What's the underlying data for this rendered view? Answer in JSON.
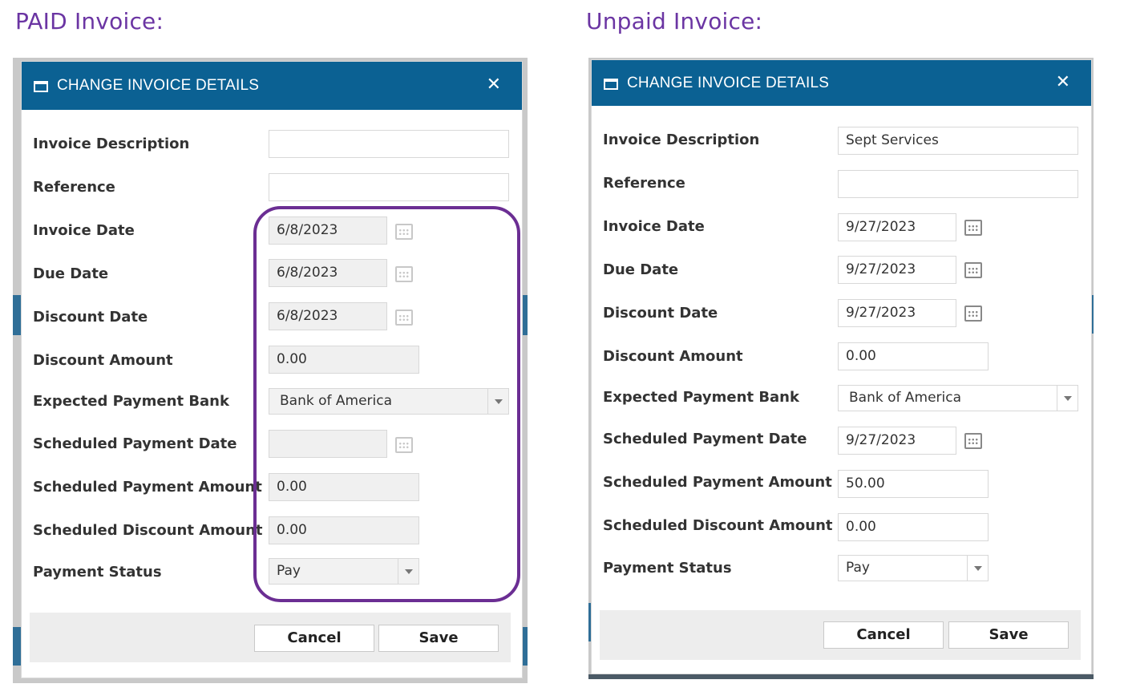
{
  "captions": {
    "paid": "PAID Invoice:",
    "unpaid": "Unpaid Invoice:"
  },
  "colors": {
    "caption": "#6b35a3",
    "titlebar": "#0b6193",
    "highlight": "#6b2e93"
  },
  "paid": {
    "title": "CHANGE INVOICE DETAILS",
    "labels": [
      "Invoice Description",
      "Reference",
      "Invoice Date",
      "Due Date",
      "Discount Date",
      "Discount Amount",
      "Expected Payment Bank",
      "Scheduled Payment Date",
      "Scheduled Payment Amount",
      "Scheduled Discount Amount",
      "Payment Status"
    ],
    "values": {
      "invoice_description": "",
      "reference": "",
      "invoice_date": "6/8/2023",
      "due_date": "6/8/2023",
      "discount_date": "6/8/2023",
      "discount_amount": "0.00",
      "expected_payment_bank": "Bank of America",
      "scheduled_payment_date": "",
      "scheduled_payment_amount": "0.00",
      "scheduled_discount_amount": "0.00",
      "payment_status": "Pay"
    },
    "buttons": {
      "cancel": "Cancel",
      "save": "Save"
    }
  },
  "unpaid": {
    "title": "CHANGE INVOICE DETAILS",
    "labels": [
      "Invoice Description",
      "Reference",
      "Invoice Date",
      "Due Date",
      "Discount Date",
      "Discount Amount",
      "Expected Payment Bank",
      "Scheduled Payment Date",
      "Scheduled Payment Amount",
      "Scheduled Discount Amount",
      "Payment Status"
    ],
    "values": {
      "invoice_description": "Sept Services",
      "reference": "",
      "invoice_date": "9/27/2023",
      "due_date": "9/27/2023",
      "discount_date": "9/27/2023",
      "discount_amount": "0.00",
      "expected_payment_bank": "Bank of America",
      "scheduled_payment_date": "9/27/2023",
      "scheduled_payment_amount": "50.00",
      "scheduled_discount_amount": "0.00",
      "payment_status": "Pay"
    },
    "buttons": {
      "cancel": "Cancel",
      "save": "Save"
    }
  }
}
